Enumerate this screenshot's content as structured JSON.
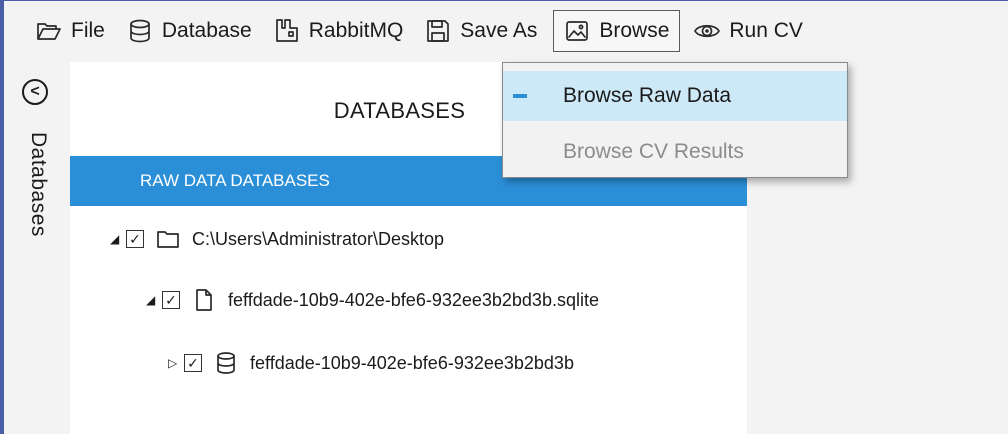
{
  "toolbar": {
    "items": [
      {
        "label": "File",
        "icon": "folder-open-icon"
      },
      {
        "label": "Database",
        "icon": "database-icon"
      },
      {
        "label": "RabbitMQ",
        "icon": "rabbitmq-icon"
      },
      {
        "label": "Save As",
        "icon": "save-icon"
      },
      {
        "label": "Browse",
        "icon": "image-icon"
      },
      {
        "label": "Run CV",
        "icon": "eye-icon"
      }
    ]
  },
  "browse_menu": {
    "items": [
      {
        "label": "Browse Raw Data",
        "state": "selected"
      },
      {
        "label": "Browse CV Results",
        "state": "disabled"
      }
    ]
  },
  "side_tab": {
    "label": "Databases",
    "collapse_glyph": "<"
  },
  "panel": {
    "title": "DATABASES",
    "section_header": "RAW DATA DATABASES",
    "tree": [
      {
        "label": "C:\\Users\\Administrator\\Desktop",
        "icon": "folder-icon",
        "checked": true,
        "expanded": true
      },
      {
        "label": "feffdade-10b9-402e-bfe6-932ee3b2bd3b.sqlite",
        "icon": "file-icon",
        "checked": true,
        "expanded": true
      },
      {
        "label": "feffdade-10b9-402e-bfe6-932ee3b2bd3b",
        "icon": "database-icon",
        "checked": true,
        "expanded": false
      }
    ]
  },
  "colors": {
    "accent": "#2b8fd8",
    "selected_menu_bg": "#cde8f6",
    "window_border": "#4a5ea8"
  }
}
